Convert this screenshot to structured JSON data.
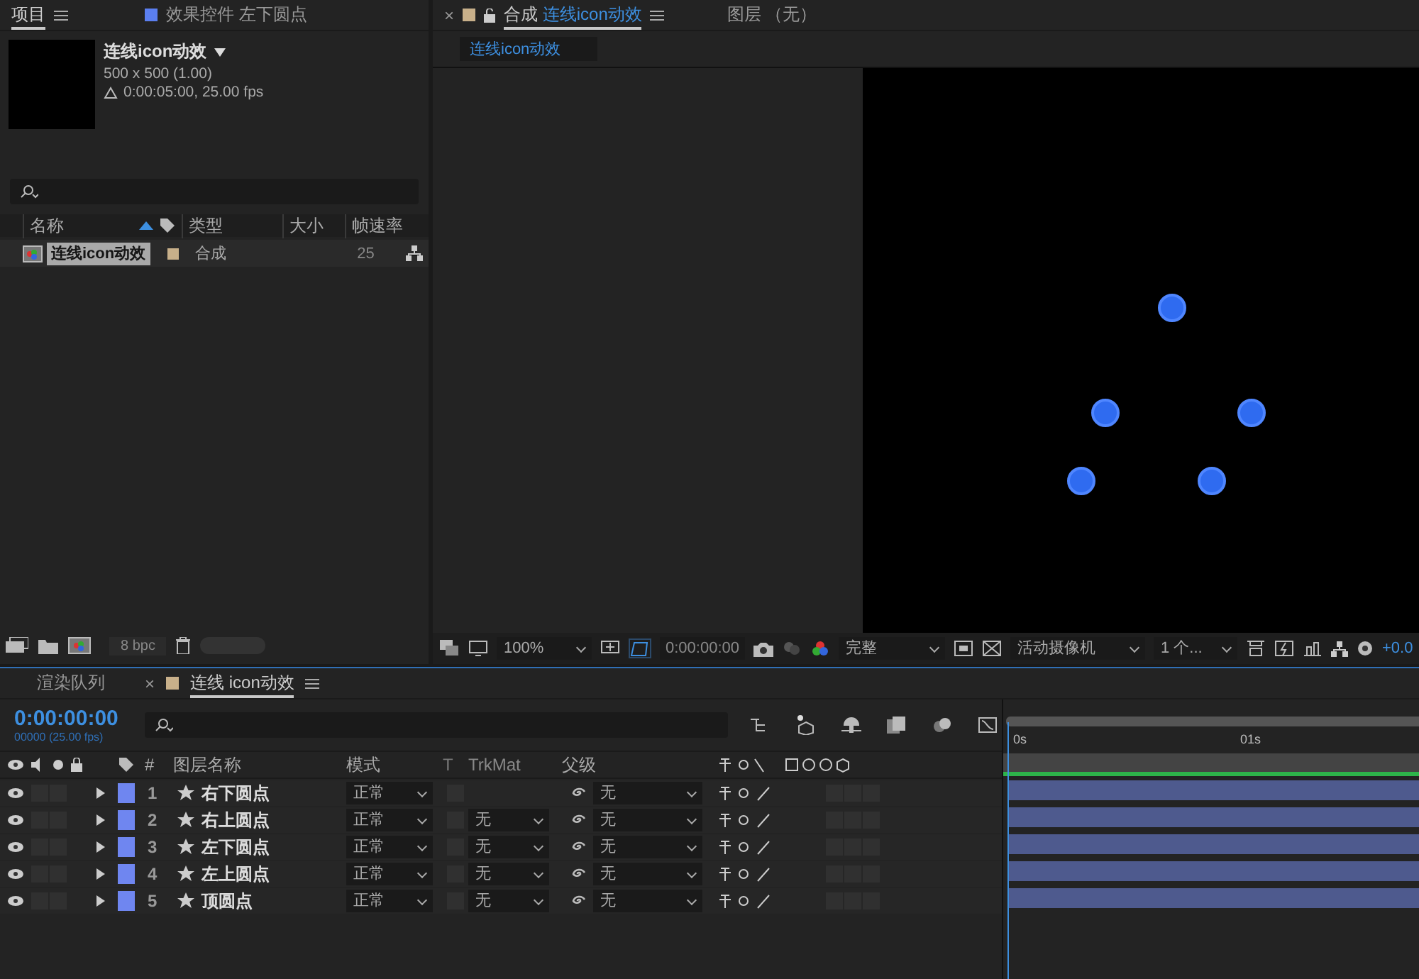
{
  "project_panel": {
    "tabs": [
      {
        "label": "项目",
        "selected": true
      },
      {
        "label": "效果控件 左下圆点",
        "selected": false,
        "color": "#5b7ff0"
      }
    ],
    "comp_name": "连线icon动效",
    "comp_size": "500 x 500 (1.00)",
    "comp_duration": "0:00:05:00, 25.00 fps",
    "columns": [
      "名称",
      "类型",
      "大小",
      "帧速率"
    ],
    "items": [
      {
        "name": "连线icon动效",
        "type": "合成",
        "fps": "25",
        "color": "#c8b08a",
        "selected": true
      }
    ],
    "bit_depth": "8 bpc"
  },
  "viewer": {
    "tabs": [
      {
        "close": "×",
        "label": "合成",
        "comp": "连线icon动效",
        "color": "#c8b08a",
        "selected": true
      },
      {
        "label": "图层 （无）",
        "selected": false
      }
    ],
    "breadcrumb": "连线icon动效",
    "toolbar": {
      "zoom": "100%",
      "timecode": "0:00:00:00",
      "resolution": "完整",
      "camera": "活动摄像机",
      "views": "1 个...",
      "exposure": "+0.0"
    }
  },
  "timeline": {
    "tabs": [
      {
        "label": "渲染队列",
        "selected": false
      },
      {
        "close": "×",
        "label": "连线 icon动效",
        "color": "#c8b08a",
        "selected": true
      }
    ],
    "timecode": "0:00:00:00",
    "frame_info": "00000 (25.00 fps)",
    "columns": {
      "number": "#",
      "name": "图层名称",
      "mode": "模式",
      "t": "T",
      "trkmat": "TrkMat",
      "parent": "父级"
    },
    "ruler": [
      "0s",
      "01s"
    ],
    "layers": [
      {
        "number": "1",
        "name": "右下圆点",
        "mode": "正常",
        "parent": "无",
        "color": "#6f86f0"
      },
      {
        "number": "2",
        "name": "右上圆点",
        "mode": "正常",
        "trkmat": "无",
        "parent": "无",
        "color": "#6f86f0"
      },
      {
        "number": "3",
        "name": "左下圆点",
        "mode": "正常",
        "trkmat": "无",
        "parent": "无",
        "color": "#6f86f0"
      },
      {
        "number": "4",
        "name": "左上圆点",
        "mode": "正常",
        "trkmat": "无",
        "parent": "无",
        "color": "#6f86f0"
      },
      {
        "number": "5",
        "name": "顶圆点",
        "mode": "正常",
        "trkmat": "无",
        "parent": "无",
        "color": "#6f86f0"
      }
    ]
  }
}
